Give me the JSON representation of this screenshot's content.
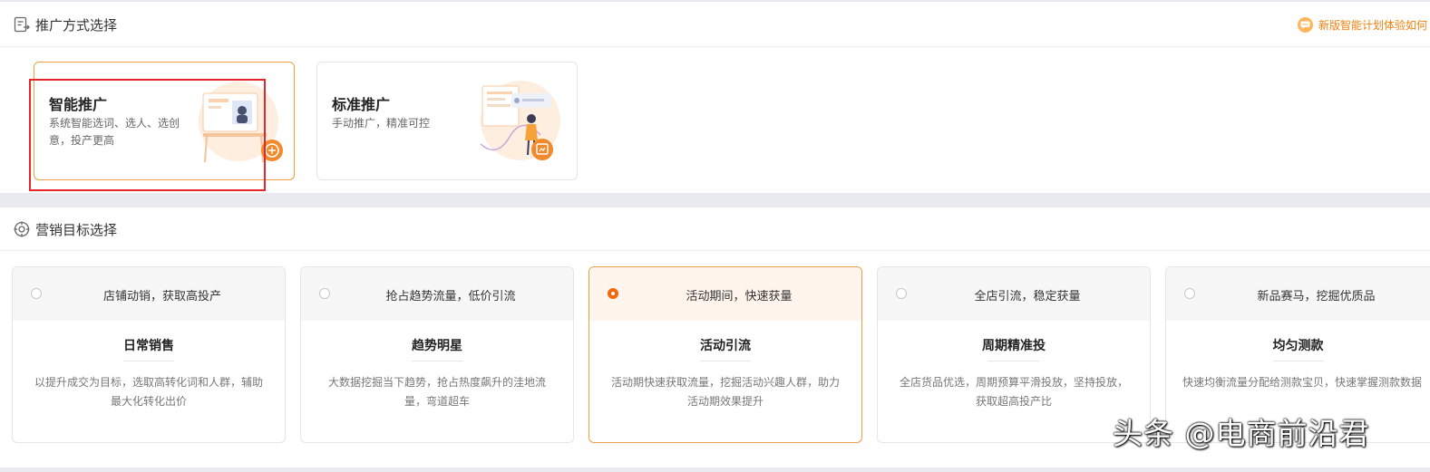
{
  "promo_section": {
    "title": "推广方式选择",
    "tip_link": "新版智能计划体验如何",
    "cards": [
      {
        "title": "智能推广",
        "desc": "系统智能选词、选人、选创意，投产更高",
        "selected": true
      },
      {
        "title": "标准推广",
        "desc": "手动推广，精准可控",
        "selected": false
      }
    ]
  },
  "goal_section": {
    "title": "营销目标选择",
    "cards": [
      {
        "head": "店铺动销，获取高投产",
        "name": "日常销售",
        "desc": "以提升成交为目标，选取高转化词和人群，辅助最大化转化出价",
        "selected": false
      },
      {
        "head": "抢占趋势流量，低价引流",
        "name": "趋势明星",
        "desc": "大数据挖掘当下趋势，抢占热度飙升的洼地流量，弯道超车",
        "selected": false
      },
      {
        "head": "活动期间，快速获量",
        "name": "活动引流",
        "desc": "活动期快速获取流量，挖掘活动兴趣人群，助力活动期效果提升",
        "selected": true
      },
      {
        "head": "全店引流，稳定获量",
        "name": "周期精准投",
        "desc": "全店货品优选，周期预算平滑投放，坚持投放，获取超高投产比",
        "selected": false
      },
      {
        "head": "新品赛马，挖掘优质品",
        "name": "均匀测款",
        "desc": "快速均衡流量分配给测款宝贝，快速掌握测款数据",
        "selected": false
      }
    ]
  },
  "watermark": "头条 @电商前沿君",
  "colors": {
    "accent": "#f26a10",
    "selected_border": "#f0a03c",
    "highlight_box": "#e5262b"
  }
}
